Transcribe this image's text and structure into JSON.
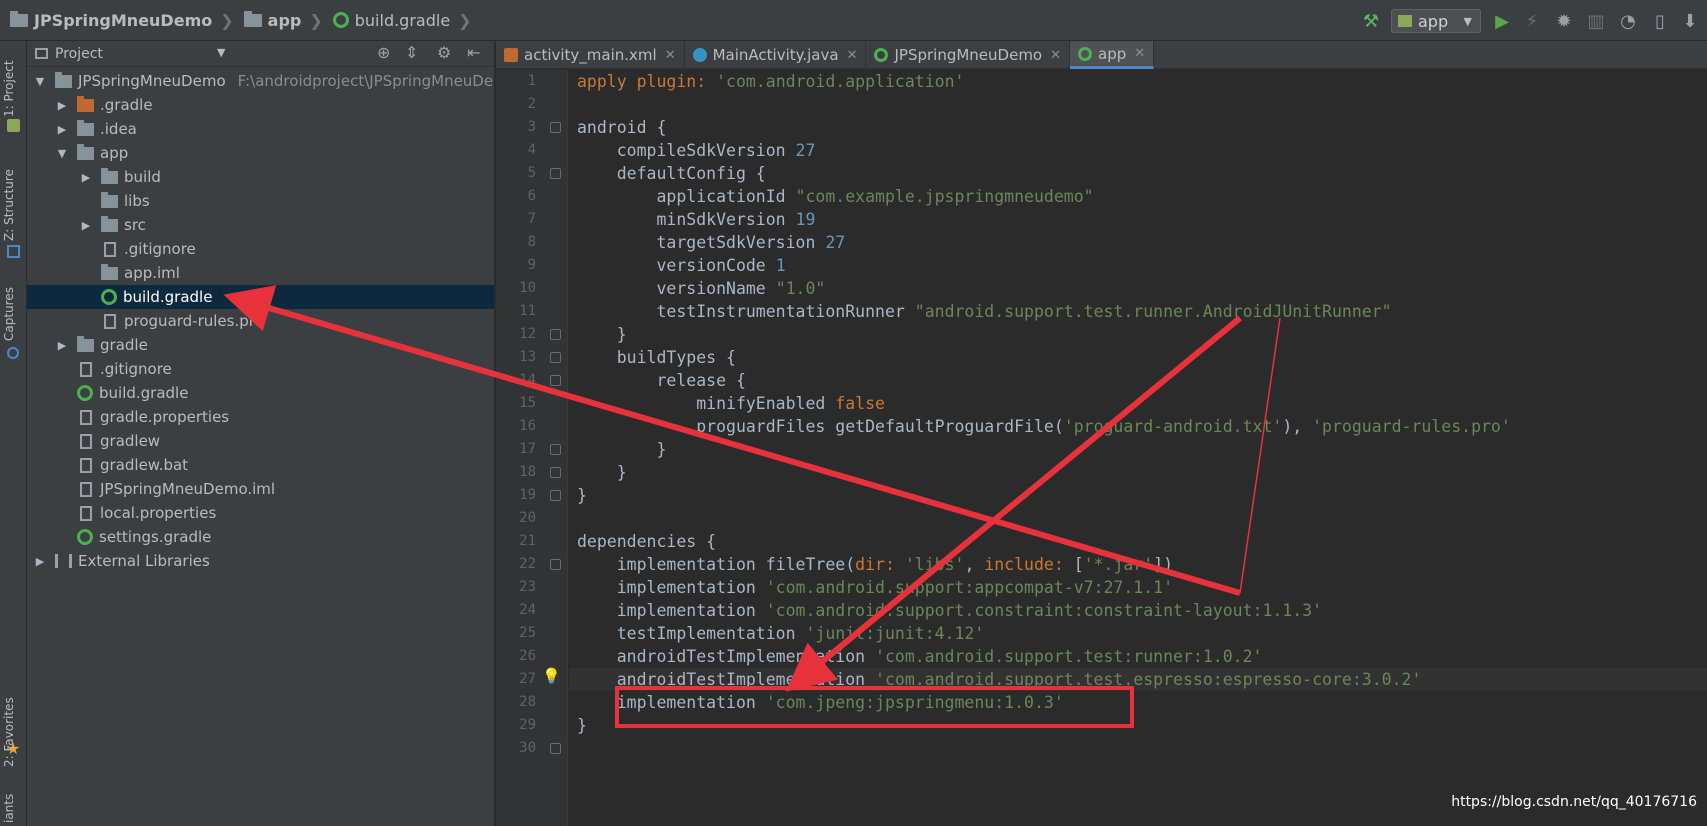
{
  "navbar": {
    "crumbs": [
      "JPSpringMneuDemo",
      "app",
      "build.gradle"
    ],
    "run_config": "app"
  },
  "toolstrip": {
    "project": "1: Project",
    "structure": "Z: Structure",
    "captures": "Captures",
    "favorites": "2: Favorites",
    "variants": "iants"
  },
  "project_panel": {
    "title": "Project",
    "items": [
      {
        "label": "JPSpringMneuDemo",
        "path": "F:\\androidproject\\JPSpringMneuDe",
        "icon": "module-folder-icon"
      },
      {
        "label": ".gradle",
        "icon": "folder-icon-orange"
      },
      {
        "label": ".idea",
        "icon": "folder-icon"
      },
      {
        "label": "app",
        "icon": "module-folder-icon"
      },
      {
        "label": "build",
        "icon": "folder-icon"
      },
      {
        "label": "libs",
        "icon": "folder-icon"
      },
      {
        "label": "src",
        "icon": "folder-icon"
      },
      {
        "label": ".gitignore",
        "icon": "file-icon"
      },
      {
        "label": "app.iml",
        "icon": "iml-file-icon"
      },
      {
        "label": "build.gradle",
        "icon": "gradle-icon"
      },
      {
        "label": "proguard-rules.pro",
        "icon": "file-icon"
      },
      {
        "label": "gradle",
        "icon": "folder-icon"
      },
      {
        "label": ".gitignore",
        "icon": "file-icon"
      },
      {
        "label": "build.gradle",
        "icon": "gradle-icon"
      },
      {
        "label": "gradle.properties",
        "icon": "properties-file-icon"
      },
      {
        "label": "gradlew",
        "icon": "file-icon"
      },
      {
        "label": "gradlew.bat",
        "icon": "file-icon"
      },
      {
        "label": "JPSpringMneuDemo.iml",
        "icon": "iml-file-icon"
      },
      {
        "label": "local.properties",
        "icon": "properties-file-icon"
      },
      {
        "label": "settings.gradle",
        "icon": "gradle-icon"
      },
      {
        "label": "External Libraries",
        "icon": "libraries-icon"
      }
    ]
  },
  "tabs": [
    {
      "label": "activity_main.xml"
    },
    {
      "label": "MainActivity.java"
    },
    {
      "label": "JPSpringMneuDemo"
    },
    {
      "label": "app"
    }
  ],
  "code": {
    "line_numbers": [
      "1",
      "2",
      "3",
      "4",
      "5",
      "6",
      "7",
      "8",
      "9",
      "10",
      "11",
      "12",
      "13",
      "14",
      "15",
      "16",
      "17",
      "18",
      "19",
      "20",
      "21",
      "22",
      "23",
      "24",
      "25",
      "26",
      "27",
      "28",
      "29",
      "30"
    ],
    "l1": {
      "a": "apply ",
      "b": "plugin: ",
      "c": "'com.android.application'"
    },
    "l3": "android {",
    "l4": {
      "a": "    compileSdkVersion ",
      "b": "27"
    },
    "l5": "    defaultConfig {",
    "l6": {
      "a": "        applicationId ",
      "b": "\"com.example.jpspringmneudemo\""
    },
    "l7": {
      "a": "        minSdkVersion ",
      "b": "19"
    },
    "l8": {
      "a": "        targetSdkVersion ",
      "b": "27"
    },
    "l9": {
      "a": "        versionCode ",
      "b": "1"
    },
    "l10": {
      "a": "        versionName ",
      "b": "\"1.0\""
    },
    "l11": {
      "a": "        testInstrumentationRunner ",
      "b": "\"android.support.test.runner.AndroidJUnitRunner\""
    },
    "l12": "    }",
    "l13": "    buildTypes {",
    "l14": "        release {",
    "l15": {
      "a": "            minifyEnabled ",
      "b": "false"
    },
    "l16": {
      "a": "            proguardFiles getDefaultProguardFile(",
      "b": "'proguard-android.txt'",
      "c": "), ",
      "d": "'proguard-rules.pro'"
    },
    "l17": "        }",
    "l18": "    }",
    "l19": "}",
    "l21": "dependencies {",
    "l22": {
      "a": "    implementation fileTree(",
      "b": "dir: ",
      "c": "'libs'",
      "d": ", ",
      "e": "include: ",
      "f": "[",
      "g": "'*.jar'",
      "h": "])"
    },
    "l23": {
      "a": "    implementation ",
      "b": "'com.android.support:appcompat-v7:27.1.1'"
    },
    "l24": {
      "a": "    implementation ",
      "b": "'com.android.support.constraint:constraint-layout:1.1.3'"
    },
    "l25": {
      "a": "    testImplementation ",
      "b": "'junit:junit:4.12'"
    },
    "l26": {
      "a": "    androidTestImplementation ",
      "b": "'com.android.support.test:runner:1.0.2'"
    },
    "l27": {
      "a": "    androidTestImplementation ",
      "b": "'com.android.support.test.espresso:espresso-core:3.0.2'"
    },
    "l28": {
      "a": "    implementation ",
      "b": "'com.jpeng:jpspringmenu:1.0.3'"
    },
    "l29": "}"
  },
  "watermark": "https://blog.csdn.net/qq_40176716",
  "colors": {
    "annotation_red": "#e8323b",
    "selection": "#0d293e",
    "keyword": "#cc7832",
    "string": "#6a8759",
    "number": "#6897bb"
  }
}
